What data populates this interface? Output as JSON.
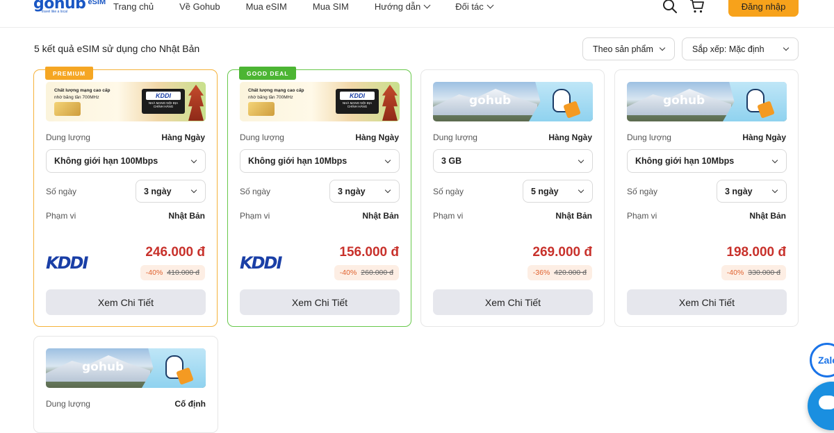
{
  "header": {
    "logo_main": "gohub",
    "logo_sub": "eSIM",
    "logo_tagline": "travel like a local",
    "nav": [
      {
        "label": "Trang chủ",
        "dropdown": false
      },
      {
        "label": "Về Gohub",
        "dropdown": false
      },
      {
        "label": "Mua eSIM",
        "dropdown": false
      },
      {
        "label": "Mua SIM",
        "dropdown": false
      },
      {
        "label": "Hướng dẫn",
        "dropdown": true
      },
      {
        "label": "Đối tác",
        "dropdown": true
      }
    ],
    "icons": [
      "search-icon",
      "cart-icon"
    ],
    "login_label": "Đăng nhập",
    "accent_color": "#f7a21b"
  },
  "results": {
    "title": "5 kết quả eSIM sử dụng cho Nhật Bản",
    "filter_label": "Theo sản phẩm",
    "sort_label": "Sắp xếp: Mặc định"
  },
  "labels": {
    "capacity": "Dung lượng",
    "days": "Số ngày",
    "scope": "Phạm vi",
    "detail_button": "Xem Chi Tiết"
  },
  "banner_kddi": {
    "line1": "Chất lượng mạng cao cấp",
    "line2": "nhờ băng tần 700MHz",
    "logo": "KDDI",
    "logo_sub": "NHÀ MẠNG NỘI ĐỊA CHÍNH HÃNG"
  },
  "banner_gohub": {
    "text": "gohub"
  },
  "cards": [
    {
      "ribbon": "PREMIUM",
      "banner": "kddi",
      "capacity_type": "Hàng Ngày",
      "plan": "Không giới hạn 100Mbps",
      "days": "3 ngày",
      "scope": "Nhật Bản",
      "carrier": "KDDI",
      "price": "246.000 đ",
      "discount": "-40%",
      "old_price": "410.000 đ"
    },
    {
      "ribbon": "GOOD DEAL",
      "banner": "kddi",
      "capacity_type": "Hàng Ngày",
      "plan": "Không giới hạn 10Mbps",
      "days": "3 ngày",
      "scope": "Nhật Bản",
      "carrier": "KDDI",
      "price": "156.000 đ",
      "discount": "-40%",
      "old_price": "260.000 đ"
    },
    {
      "ribbon": "",
      "banner": "gohub",
      "capacity_type": "Hàng Ngày",
      "plan": "3 GB",
      "days": "5 ngày",
      "scope": "Nhật Bản",
      "carrier": "",
      "price": "269.000 đ",
      "discount": "-36%",
      "old_price": "420.000 đ"
    },
    {
      "ribbon": "",
      "banner": "gohub",
      "capacity_type": "Hàng Ngày",
      "plan": "Không giới hạn 10Mbps",
      "days": "3 ngày",
      "scope": "Nhật Bản",
      "carrier": "",
      "price": "198.000 đ",
      "discount": "-40%",
      "old_price": "330.000 đ"
    },
    {
      "ribbon": "",
      "banner": "gohub",
      "capacity_type": "Cố định"
    }
  ],
  "widgets": {
    "zalo_label": "Zalo",
    "chat_icon": "chat-bubble-icon"
  }
}
